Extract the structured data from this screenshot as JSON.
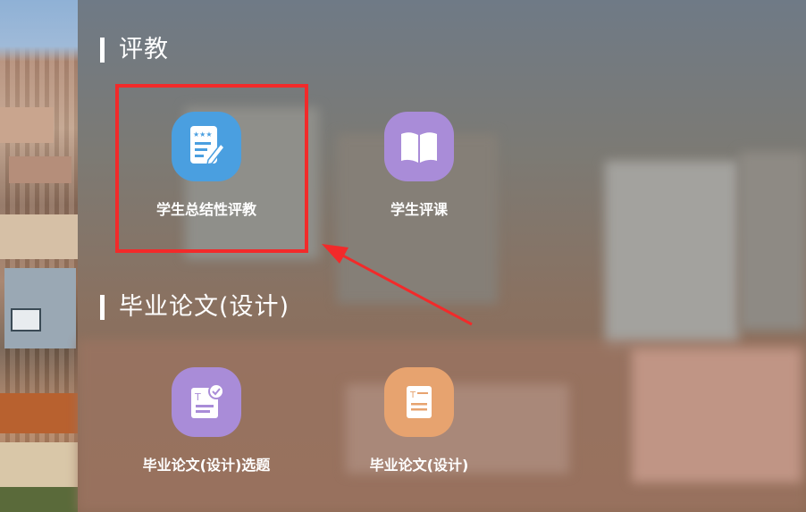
{
  "sections": [
    {
      "title": "评教",
      "apps": [
        {
          "label": "学生总结性评教",
          "icon": "evaluation-form-icon",
          "color": "#4a9fe0"
        },
        {
          "label": "学生评课",
          "icon": "open-book-icon",
          "color": "#a98cd8"
        }
      ]
    },
    {
      "title": "毕业论文(设计)",
      "apps": [
        {
          "label": "毕业论文(设计)选题",
          "icon": "topic-selection-icon",
          "color": "#a98cd8"
        },
        {
          "label": "毕业论文(设计)",
          "icon": "document-icon",
          "color": "#e7a36f"
        }
      ]
    }
  ],
  "annotation": {
    "highlight_color": "#f22a2a"
  }
}
